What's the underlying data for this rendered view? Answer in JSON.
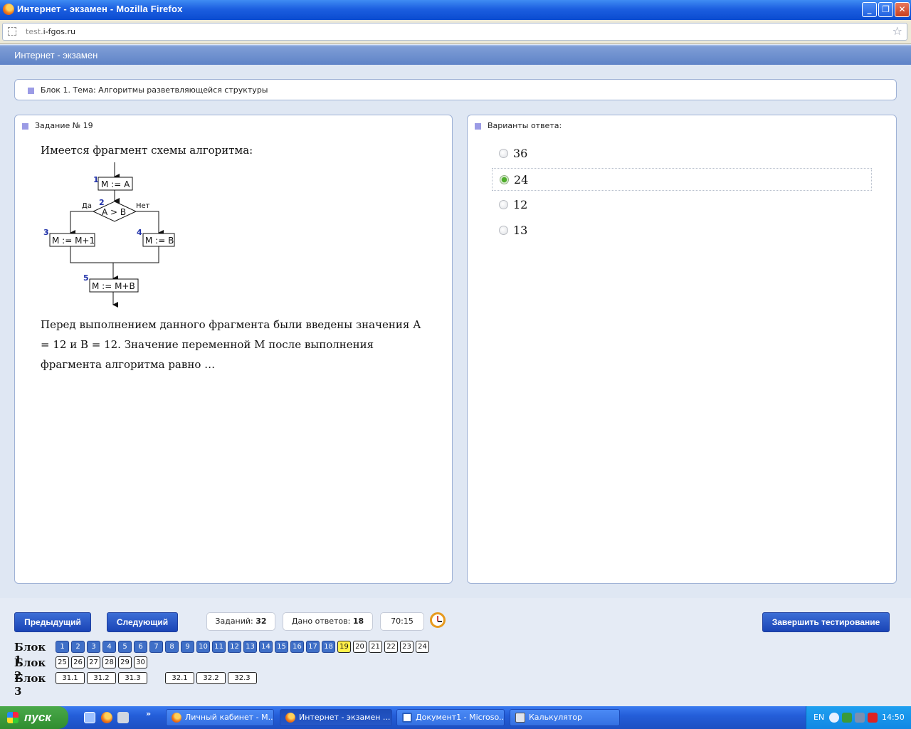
{
  "window": {
    "title": "Интернет - экзамен - Mozilla Firefox",
    "minimize": "_",
    "maximize": "❐",
    "close": "✕"
  },
  "address": {
    "url_prefix": "test.",
    "url_domain": "i-fgos.ru"
  },
  "app": {
    "title": "Интернет - экзамен"
  },
  "block": {
    "caption": "Блок 1. Тема: Алгоритмы разветвляющейся структуры"
  },
  "task": {
    "caption": "Задание № 19",
    "intro": "Имеется фрагмент схемы алгоритма:",
    "question": "Перед выполнением данного фрагмента были введены значения А = 12 и В = 12. Значение переменной М после выполнения фрагмента алгоритма равно …",
    "flowchart": {
      "step1_num": "1",
      "step1": "M := A",
      "step2_num": "2",
      "condition": "A > B",
      "yes": "Да",
      "no": "Нет",
      "step3_num": "3",
      "step3": "M := M+1",
      "step4_num": "4",
      "step4": "M := B",
      "step5_num": "5",
      "step5": "M := M+B"
    }
  },
  "answers": {
    "caption": "Варианты ответа:",
    "options": [
      {
        "label": "36",
        "selected": false
      },
      {
        "label": "24",
        "selected": true
      },
      {
        "label": "12",
        "selected": false
      },
      {
        "label": "13",
        "selected": false
      }
    ]
  },
  "controls": {
    "prev": "Предыдущий",
    "next": "Следующий",
    "tasks_label": "Заданий:",
    "tasks_count": "32",
    "answered_label": "Дано ответов:",
    "answered_count": "18",
    "timer": "70:15",
    "finish": "Завершить тестирование"
  },
  "navigator": {
    "blocks": [
      {
        "label": "Блок 1",
        "items": [
          "1",
          "2",
          "3",
          "4",
          "5",
          "6",
          "7",
          "8",
          "9",
          "10",
          "11",
          "12",
          "13",
          "14",
          "15",
          "16",
          "17",
          "18",
          "19",
          "20",
          "21",
          "22",
          "23",
          "24"
        ]
      },
      {
        "label": "Блок 2",
        "items": [
          "25",
          "26",
          "27",
          "28",
          "29",
          "30"
        ]
      },
      {
        "label": "Блок 3",
        "items": [
          "31.1",
          "31.2",
          "31.3",
          "32.1",
          "32.2",
          "32.3"
        ]
      }
    ],
    "answered_through": 18,
    "current": "19"
  },
  "taskbar": {
    "start": "пуск",
    "more": "»",
    "tasks": [
      "Личный кабинет - M...",
      "Интернет - экзамен ...",
      "Документ1 - Microso...",
      "Калькулятор"
    ],
    "lang": "EN",
    "time": "14:50"
  },
  "colors": {
    "accent": "#3f6fc7",
    "current_item": "#fff04a",
    "selected_radio": "#4fae2c"
  }
}
